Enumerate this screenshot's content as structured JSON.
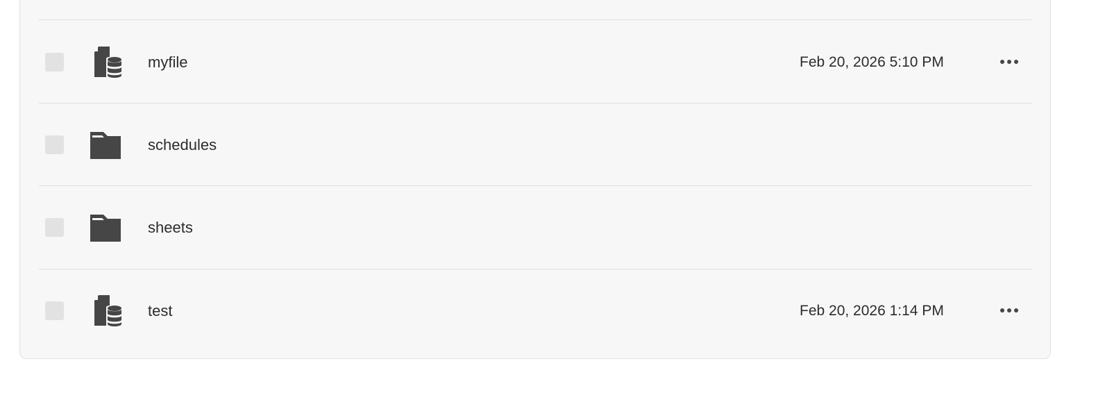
{
  "files": {
    "rows": [
      {
        "name": "myfile",
        "type_icon": "dataset-file-icon",
        "modified": "Feb 20, 2026 5:10 PM",
        "has_menu": true
      },
      {
        "name": "schedules",
        "type_icon": "folder-icon",
        "modified": "",
        "has_menu": false
      },
      {
        "name": "sheets",
        "type_icon": "folder-icon",
        "modified": "",
        "has_menu": false
      },
      {
        "name": "test",
        "type_icon": "dataset-file-icon",
        "modified": "Feb 20, 2026 1:14 PM",
        "has_menu": true
      }
    ],
    "more_icon": "more-horizontal-icon"
  },
  "colors": {
    "panel_bg": "#f7f7f7",
    "icon": "#464646",
    "text": "#2c2c2c",
    "checkbox": "#e2e2e2",
    "divider": "#dedede"
  }
}
